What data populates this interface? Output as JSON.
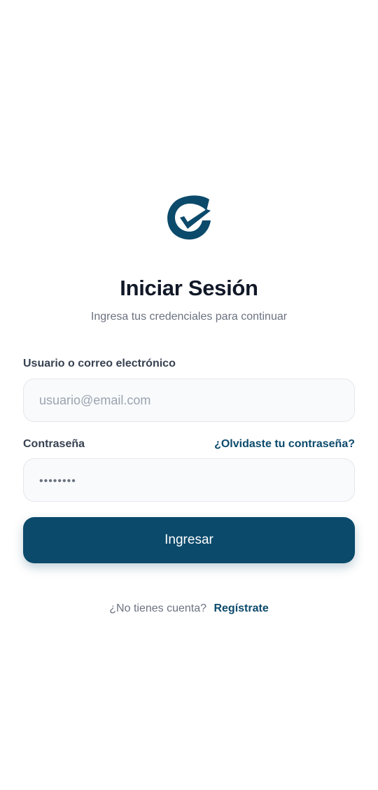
{
  "brand": {
    "logo_icon": "brand-check-logo-icon",
    "accent": "#0b4a6b"
  },
  "header": {
    "title": "Iniciar Sesión",
    "subtitle": "Ingresa tus credenciales para continuar"
  },
  "form": {
    "user_label": "Usuario o correo electrónico",
    "user_placeholder": "usuario@email.com",
    "user_value": "",
    "password_label": "Contraseña",
    "forgot_link": "¿Olvidaste tu contraseña?",
    "password_placeholder": "••••••••",
    "password_value": "",
    "submit_label": "Ingresar"
  },
  "footer": {
    "question": "¿No tienes cuenta?",
    "signup_link": "Regístrate"
  }
}
